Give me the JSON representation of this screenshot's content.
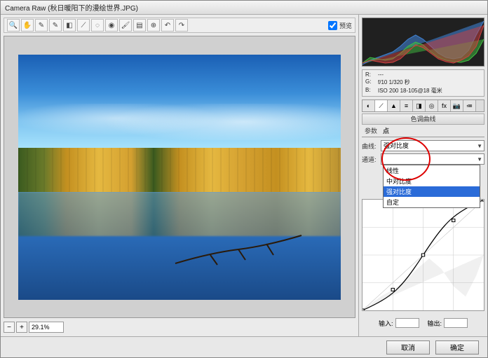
{
  "window": {
    "title": "Camera Raw  (秋日暖阳下的漫绘世界.JPG)"
  },
  "toolbar": {
    "preview_label": "预览",
    "icons": [
      "zoom",
      "hand",
      "eyedrop",
      "eyedrop2",
      "crop",
      "straighten",
      "spot",
      "redeye",
      "brush",
      "gradient",
      "target",
      "rotate-l",
      "rotate-r"
    ]
  },
  "zoom": {
    "value": "29.1%"
  },
  "meta": {
    "r": "R:",
    "g": "G:",
    "b": "B:",
    "exposure": "f/10  1/320 秒",
    "iso": "ISO 200  18-105@18 毫米"
  },
  "panel": {
    "title": "色调曲线",
    "subtabs": [
      "参数",
      "点"
    ],
    "curve_label": "曲线:",
    "curve_value": "强对比度",
    "channel_label": "通道:",
    "dropdown": [
      "线性",
      "中对比度",
      "强对比度",
      "自定"
    ],
    "dropdown_selected_index": 2,
    "input_label": "输入:",
    "output_label": "输出:"
  },
  "footer": {
    "cancel": "取消",
    "ok": "确定"
  },
  "chart_data": [
    {
      "type": "area",
      "title": "Histogram",
      "xlabel": "",
      "ylabel": "",
      "x": [
        0,
        16,
        32,
        48,
        64,
        80,
        96,
        112,
        128,
        144,
        160,
        176,
        192,
        208,
        224,
        240,
        255
      ],
      "series": [
        {
          "name": "R",
          "color": "#d04040",
          "values": [
            5,
            8,
            6,
            4,
            5,
            10,
            20,
            30,
            25,
            18,
            10,
            6,
            4,
            8,
            14,
            30,
            60
          ]
        },
        {
          "name": "G",
          "color": "#40c040",
          "values": [
            6,
            12,
            10,
            8,
            10,
            18,
            28,
            35,
            30,
            20,
            12,
            8,
            6,
            5,
            8,
            18,
            40
          ]
        },
        {
          "name": "B",
          "color": "#4080d0",
          "values": [
            4,
            10,
            14,
            18,
            22,
            30,
            40,
            45,
            38,
            26,
            16,
            10,
            8,
            10,
            20,
            45,
            70
          ]
        }
      ],
      "xlim": [
        0,
        255
      ],
      "ylim": [
        0,
        80
      ]
    },
    {
      "type": "line",
      "title": "Tone Curve — 强对比度",
      "xlabel": "输入",
      "ylabel": "输出",
      "xlim": [
        0,
        255
      ],
      "ylim": [
        0,
        255
      ],
      "points": [
        [
          0,
          0
        ],
        [
          64,
          48
        ],
        [
          128,
          128
        ],
        [
          192,
          208
        ],
        [
          255,
          255
        ]
      ],
      "grid": true
    }
  ]
}
